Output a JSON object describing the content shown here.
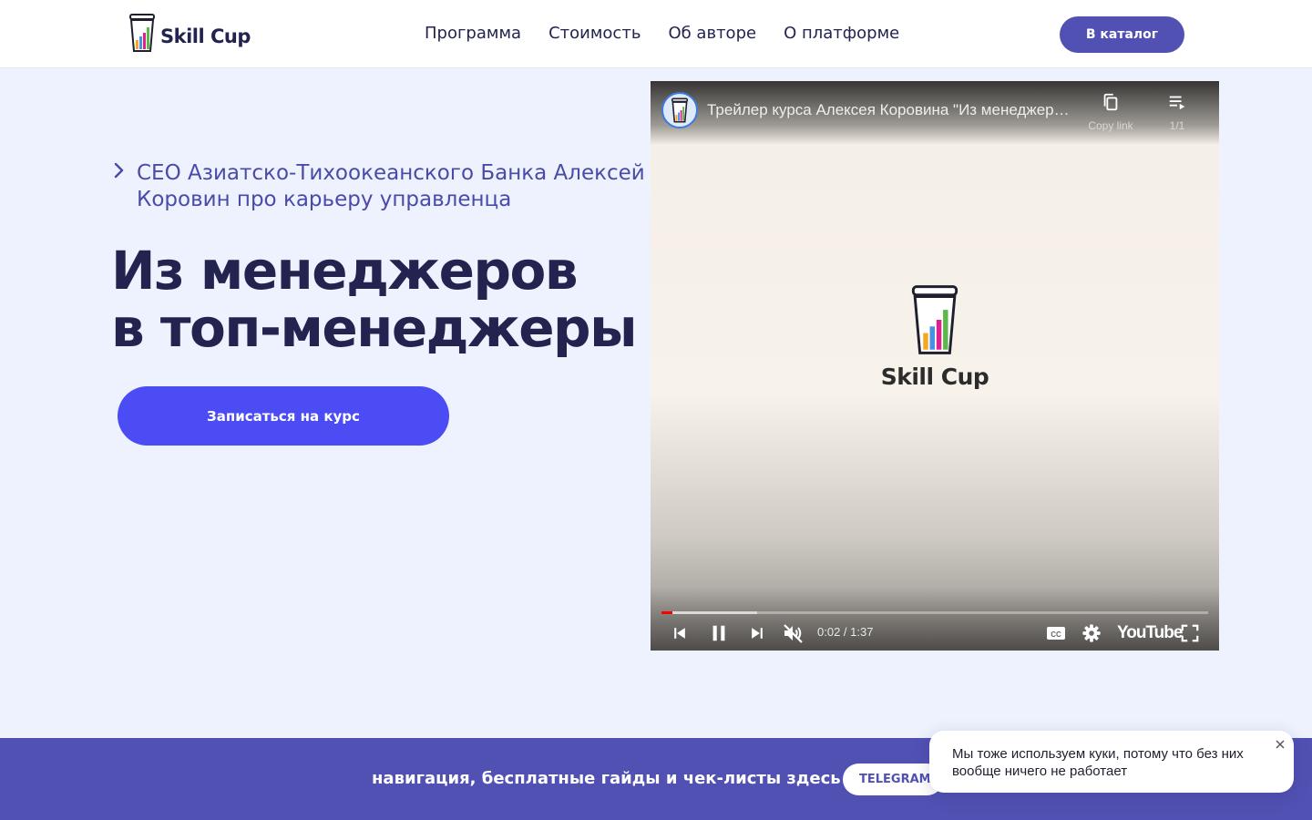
{
  "header": {
    "logo_text": "Skill Cup",
    "nav": [
      "Программа",
      "Стоимость",
      "Об авторе",
      "О платформе"
    ],
    "catalog_button": "В каталог"
  },
  "hero": {
    "subtitle": "CEO Азиатско-Тихоокеанского Банка Алексей Коровин про карьеру управленца",
    "title_line1": "Из менеджеров",
    "title_line2": "в топ-менеджеры",
    "enroll_button": "Записаться на курс"
  },
  "video": {
    "title": "Трейлер курса Алексея Коровина \"Из менеджеров в топ-менеджеры\"",
    "copy_link_label": "Copy link",
    "playlist_count": "1/1",
    "center_logo_text": "Skill Cup",
    "time": "0:02 / 1:37",
    "played_fraction": 0.02,
    "buffered_fraction": 0.175,
    "youtube_label": "YouTube",
    "icons": [
      "skip-previous-icon",
      "pause-icon",
      "skip-next-icon",
      "volume-muted-icon",
      "captions-icon",
      "settings-icon",
      "fullscreen-icon",
      "copy-icon",
      "playlist-icon"
    ],
    "progress_color": "#ff0000"
  },
  "banner": {
    "text": "навигация, бесплатные гайды и чек-листы здесь",
    "telegram_button": "TELEGRAM"
  },
  "cookie": {
    "text": "Мы тоже используем куки, потому что без них вообще ничего не работает"
  },
  "colors": {
    "page_bg": "#edf2fe",
    "accent": "#5151b4",
    "cta": "#4c4cf5",
    "heading": "#23234f",
    "subtitle": "#4a4aa8"
  }
}
